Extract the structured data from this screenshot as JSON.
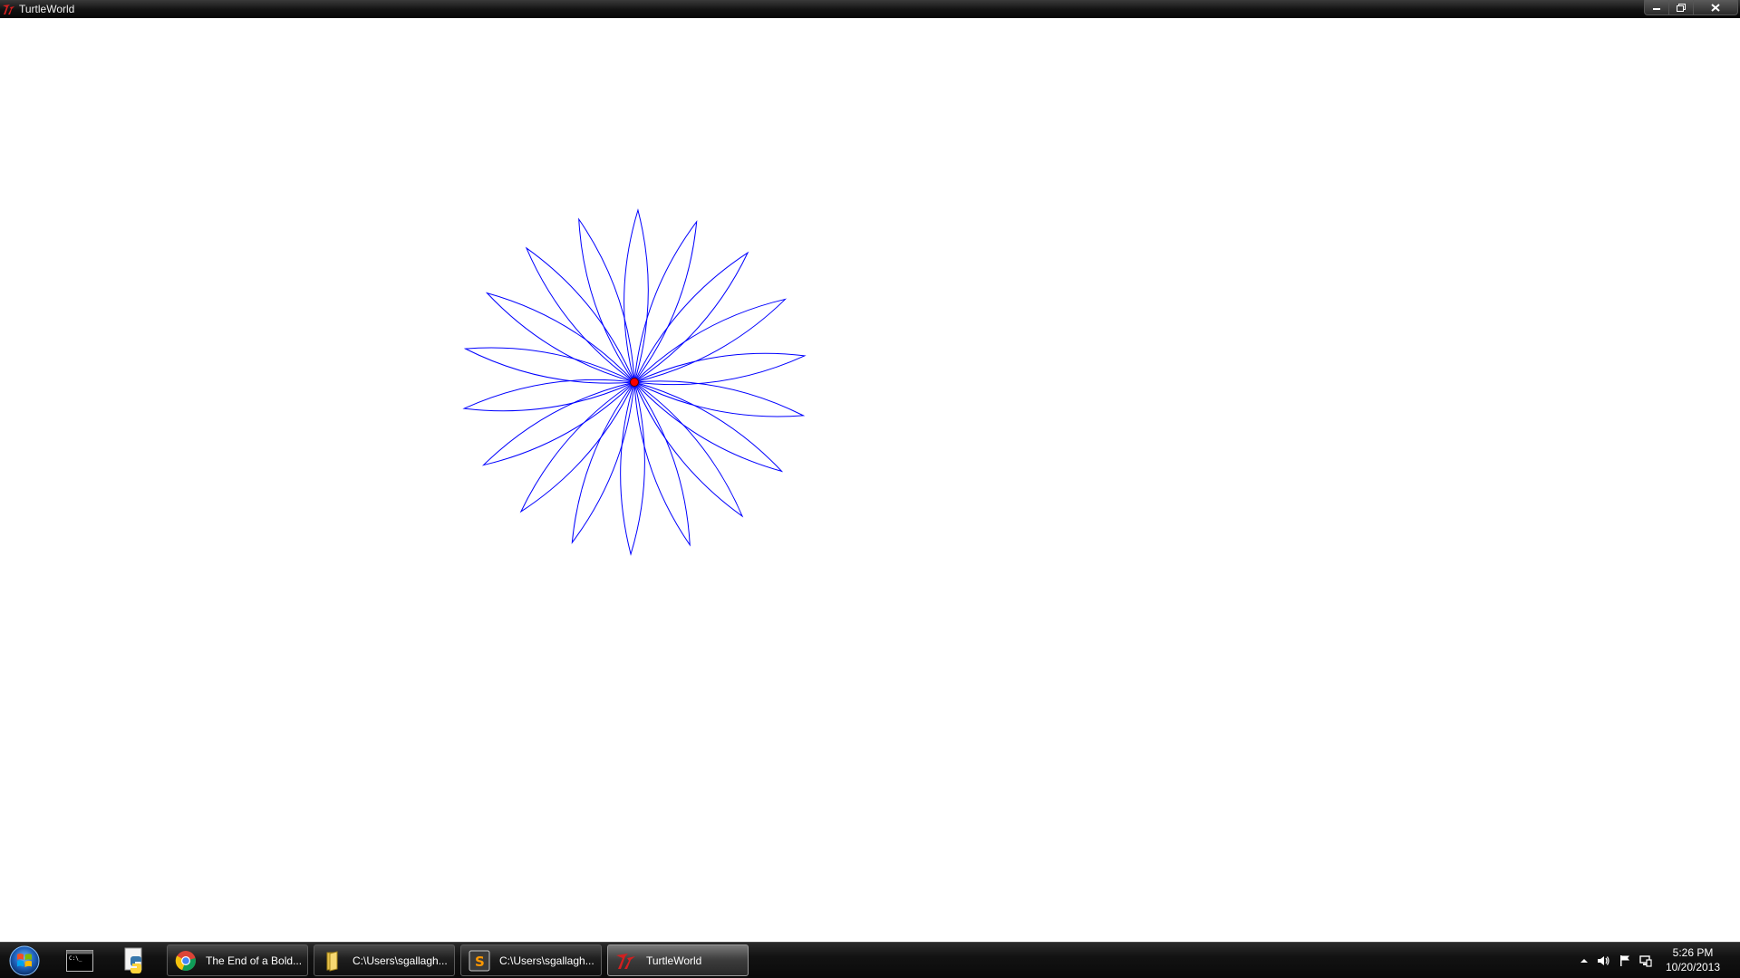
{
  "window": {
    "title": "TurtleWorld"
  },
  "taskbar": {
    "tasks": [
      {
        "label": "The End of a Bold...",
        "icon": "chrome-icon"
      },
      {
        "label": "C:\\Users\\sgallagh...",
        "icon": "folder-icon"
      },
      {
        "label": "C:\\Users\\sgallagh...",
        "icon": "sublime-text-icon"
      },
      {
        "label": "TurtleWorld",
        "icon": "tk-feather-icon",
        "active": true
      }
    ],
    "pinned": [
      "command-prompt-icon",
      "python-icon"
    ]
  },
  "clock": {
    "time": "5:26 PM",
    "date": "10/20/2013"
  },
  "drawing": {
    "petals": 18,
    "stroke_color": "#0000ff",
    "turtle_color": "#ff0000"
  },
  "colors": {
    "titlebar": "#111111",
    "taskbar": "#0a0a0a",
    "canvas": "#ffffff"
  }
}
